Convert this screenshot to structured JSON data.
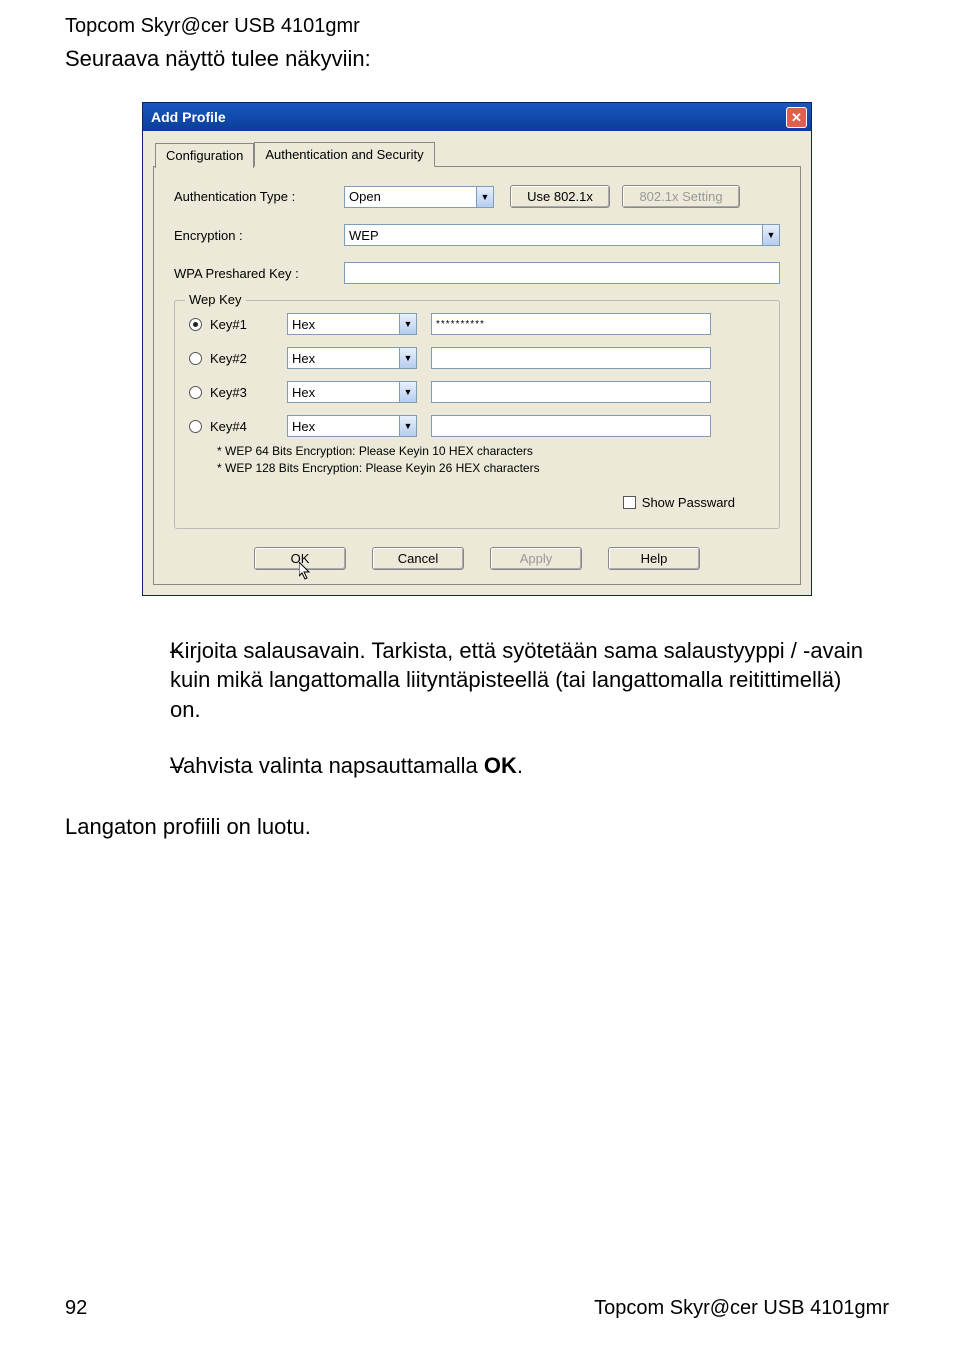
{
  "header": "Topcom Skyr@cer USB 4101gmr",
  "subheader": "Seuraava näyttö tulee näkyviin:",
  "dialog": {
    "title": "Add Profile",
    "tabs": {
      "t1": "Configuration",
      "t2": "Authentication and Security"
    },
    "auth_label": "Authentication Type :",
    "auth_value": "Open",
    "use8021x": "Use 802.1x",
    "setting8021x": "802.1x Setting",
    "enc_label": "Encryption :",
    "enc_value": "WEP",
    "psk_label": "WPA Preshared Key :",
    "psk_value": "",
    "wep_legend": "Wep Key",
    "keys": {
      "k1": {
        "label": "Key#1",
        "type": "Hex",
        "value": "**********"
      },
      "k2": {
        "label": "Key#2",
        "type": "Hex",
        "value": ""
      },
      "k3": {
        "label": "Key#3",
        "type": "Hex",
        "value": ""
      },
      "k4": {
        "label": "Key#4",
        "type": "Hex",
        "value": ""
      }
    },
    "note1": "* WEP 64 Bits Encryption:   Please Keyin 10 HEX characters",
    "note2": "* WEP 128 Bits Encryption:   Please Keyin 26 HEX characters",
    "showpass": "Show Passward",
    "btn_ok": "OK",
    "btn_cancel": "Cancel",
    "btn_apply": "Apply",
    "btn_help": "Help"
  },
  "bullets": {
    "dash": "–",
    "b1": "Kirjoita salausavain. Tarkista, että syötetään sama salaustyyppi / -avain kuin mikä langattomalla liityntäpisteellä (tai langattomalla reitittimellä) on.",
    "b2_pre": "Vahvista valinta napsauttamalla ",
    "b2_bold": "OK",
    "b2_post": "."
  },
  "final": "Langaton profiili on luotu.",
  "footer": {
    "page": "92",
    "right": "Topcom Skyr@cer USB 4101gmr"
  }
}
